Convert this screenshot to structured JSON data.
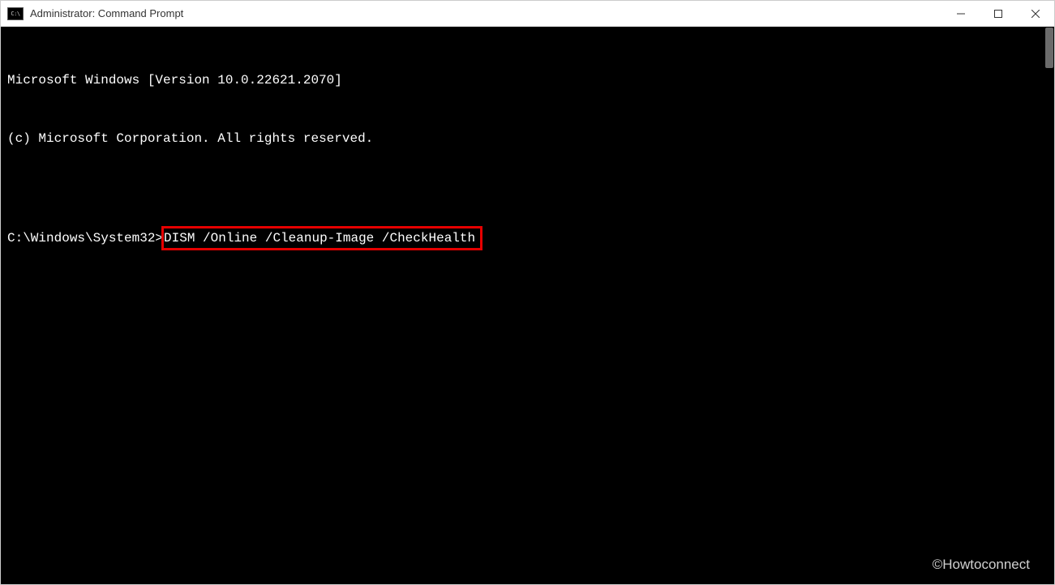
{
  "titlebar": {
    "icon_text": "C:\\",
    "title": "Administrator: Command Prompt"
  },
  "terminal": {
    "line1": "Microsoft Windows [Version 10.0.22621.2070]",
    "line2": "(c) Microsoft Corporation. All rights reserved.",
    "blank": "",
    "prompt": "C:\\Windows\\System32>",
    "command": "DISM /Online /Cleanup-Image /CheckHealth"
  },
  "watermark": "©Howtoconnect"
}
